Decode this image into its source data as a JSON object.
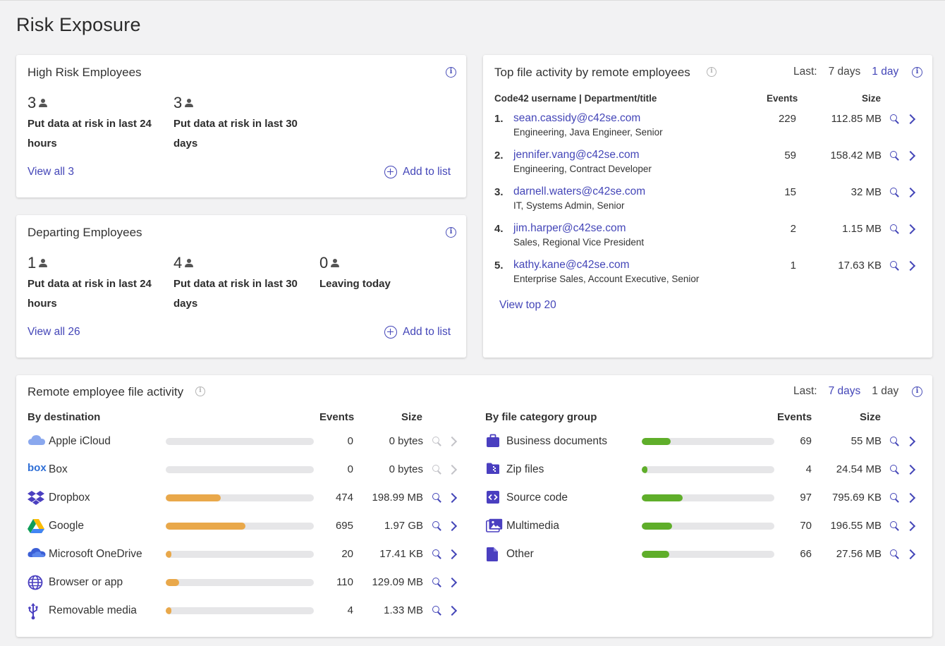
{
  "page_title": "Risk Exposure",
  "high_risk": {
    "title": "High Risk Employees",
    "stats": [
      {
        "count": "3",
        "desc": "Put data at risk in last 24 hours"
      },
      {
        "count": "3",
        "desc": "Put data at risk in last 30 days"
      }
    ],
    "view_all": "View all 3",
    "add_to_list": "Add to list"
  },
  "departing": {
    "title": "Departing Employees",
    "stats": [
      {
        "count": "1",
        "desc": "Put data at risk in last 24 hours"
      },
      {
        "count": "4",
        "desc": "Put data at risk in last 30 days"
      },
      {
        "count": "0",
        "desc": "Leaving today"
      }
    ],
    "view_all": "View all 26",
    "add_to_list": "Add to list"
  },
  "top_activity": {
    "title": "Top file activity by remote employees",
    "last_label": "Last:",
    "periods": [
      "7 days",
      "1 day"
    ],
    "active_period": "1 day",
    "col_user": "Code42 username | Department/title",
    "col_events": "Events",
    "col_size": "Size",
    "rows": [
      {
        "rank": "1.",
        "email": "sean.cassidy@c42se.com",
        "dept": "Engineering, Java Engineer, Senior",
        "events": "229",
        "size": "112.85 MB"
      },
      {
        "rank": "2.",
        "email": "jennifer.vang@c42se.com",
        "dept": "Engineering, Contract Developer",
        "events": "59",
        "size": "158.42 MB"
      },
      {
        "rank": "3.",
        "email": "darnell.waters@c42se.com",
        "dept": "IT, Systems Admin, Senior",
        "events": "15",
        "size": "32 MB"
      },
      {
        "rank": "4.",
        "email": "jim.harper@c42se.com",
        "dept": "Sales, Regional Vice President",
        "events": "2",
        "size": "1.15 MB"
      },
      {
        "rank": "5.",
        "email": "kathy.kane@c42se.com",
        "dept": "Enterprise Sales, Account Executive, Senior",
        "events": "1",
        "size": "17.63 KB"
      }
    ],
    "view_top": "View top 20"
  },
  "remote_activity": {
    "title": "Remote employee file activity",
    "last_label": "Last:",
    "periods": [
      "7 days",
      "1 day"
    ],
    "active_period": "7 days",
    "destination": {
      "heading": "By destination",
      "col_events": "Events",
      "col_size": "Size",
      "bar_color": "#e9a84a",
      "rows": [
        {
          "icon": "icloud-icon",
          "name": "Apple iCloud",
          "events": "0",
          "size": "0 bytes",
          "fill": 0,
          "enabled": false
        },
        {
          "icon": "box-icon",
          "name": "Box",
          "events": "0",
          "size": "0 bytes",
          "fill": 0,
          "enabled": false
        },
        {
          "icon": "dropbox-icon",
          "name": "Dropbox",
          "events": "474",
          "size": "198.99 MB",
          "fill": 0.37,
          "enabled": true
        },
        {
          "icon": "google-drive-icon",
          "name": "Google",
          "events": "695",
          "size": "1.97 GB",
          "fill": 0.54,
          "enabled": true
        },
        {
          "icon": "onedrive-icon",
          "name": "Microsoft OneDrive",
          "events": "20",
          "size": "17.41 KB",
          "fill": 0.04,
          "enabled": true
        },
        {
          "icon": "globe-icon",
          "name": "Browser or app",
          "events": "110",
          "size": "129.09 MB",
          "fill": 0.09,
          "enabled": true
        },
        {
          "icon": "usb-icon",
          "name": "Removable media",
          "events": "4",
          "size": "1.33 MB",
          "fill": 0.04,
          "enabled": true
        }
      ]
    },
    "category": {
      "heading": "By file category group",
      "col_events": "Events",
      "col_size": "Size",
      "bar_color": "#5fae2a",
      "rows": [
        {
          "icon": "briefcase-icon",
          "name": "Business documents",
          "events": "69",
          "size": "55 MB",
          "fill": 0.22
        },
        {
          "icon": "zip-icon",
          "name": "Zip files",
          "events": "4",
          "size": "24.54 MB",
          "fill": 0.04
        },
        {
          "icon": "source-code-icon",
          "name": "Source code",
          "events": "97",
          "size": "795.69 KB",
          "fill": 0.31
        },
        {
          "icon": "multimedia-icon",
          "name": "Multimedia",
          "events": "70",
          "size": "196.55 MB",
          "fill": 0.23
        },
        {
          "icon": "document-icon",
          "name": "Other",
          "events": "66",
          "size": "27.56 MB",
          "fill": 0.21
        }
      ]
    }
  }
}
